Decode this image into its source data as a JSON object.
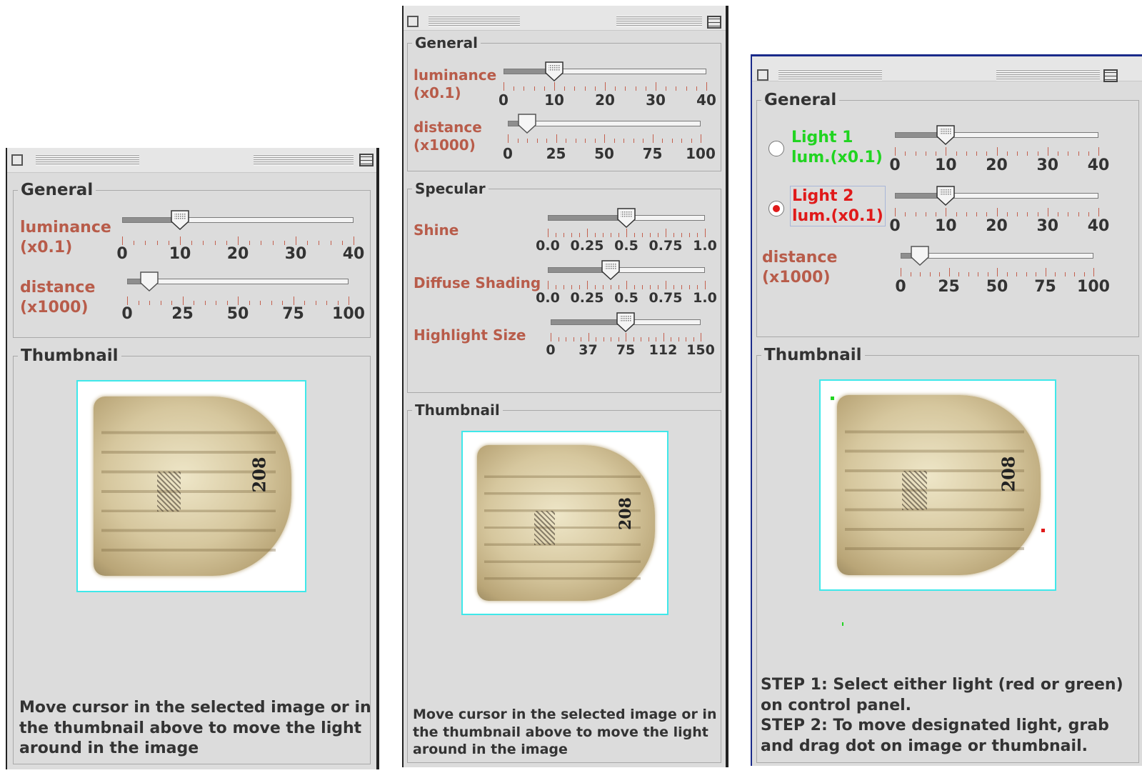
{
  "panels": [
    {
      "general_title": "General",
      "luminance_label": [
        "luminance",
        "(x0.1)"
      ],
      "luminance_ticks": [
        "0",
        "10",
        "20",
        "30",
        "40"
      ],
      "luminance_value": 10,
      "distance_label": [
        "distance",
        "(x1000)"
      ],
      "distance_ticks": [
        "0",
        "25",
        "50",
        "75",
        "100"
      ],
      "distance_value": 10,
      "thumbnail_title": "Thumbnail",
      "tablet_number": "208",
      "note": "Move cursor in the selected image or in the thumbnail above to move the light around in the image"
    },
    {
      "general_title": "General",
      "luminance_label": [
        "luminance",
        "(x0.1)"
      ],
      "luminance_ticks": [
        "0",
        "10",
        "20",
        "30",
        "40"
      ],
      "luminance_value": 10,
      "distance_label": [
        "distance",
        "(x1000)"
      ],
      "distance_ticks": [
        "0",
        "25",
        "50",
        "75",
        "100"
      ],
      "distance_value": 10,
      "specular_title": "Specular",
      "shine_label": "Shine",
      "shine_ticks": [
        "0.0",
        "0.25",
        "0.5",
        "0.75",
        "1.0"
      ],
      "shine_value": 0.5,
      "diffuse_label": "Diffuse Shading",
      "diffuse_ticks": [
        "0.0",
        "0.25",
        "0.5",
        "0.75",
        "1.0"
      ],
      "diffuse_value": 0.4,
      "highlight_label": "Highlight Size",
      "highlight_ticks": [
        "0",
        "37",
        "75",
        "112",
        "150"
      ],
      "highlight_value": 75,
      "thumbnail_title": "Thumbnail",
      "tablet_number": "208",
      "note": "Move cursor in the selected image or in the thumbnail above to move the light around in the image"
    },
    {
      "general_title": "General",
      "light1_label": [
        "Light 1",
        "lum.(x0.1)"
      ],
      "light1_selected": false,
      "light1_color": "#21d421",
      "light1_ticks": [
        "0",
        "10",
        "20",
        "30",
        "40"
      ],
      "light1_value": 10,
      "light2_label": [
        "Light 2",
        "lum.(x0.1)"
      ],
      "light2_selected": true,
      "light2_color": "#e01a1a",
      "light2_ticks": [
        "0",
        "10",
        "20",
        "30",
        "40"
      ],
      "light2_value": 10,
      "distance_label": [
        "distance",
        "(x1000)"
      ],
      "distance_ticks": [
        "0",
        "25",
        "50",
        "75",
        "100"
      ],
      "distance_value": 10,
      "thumbnail_title": "Thumbnail",
      "tablet_number": "208",
      "note": [
        "STEP 1: Select either light (red or green)",
        "on control panel.",
        "STEP 2: To move designated light, grab",
        "and drag dot on image or thumbnail."
      ]
    }
  ],
  "colors": {
    "label_red": "#b85c4a",
    "thumb_border": "#3fe8ea",
    "panel_bg": "#dcdcdc"
  }
}
